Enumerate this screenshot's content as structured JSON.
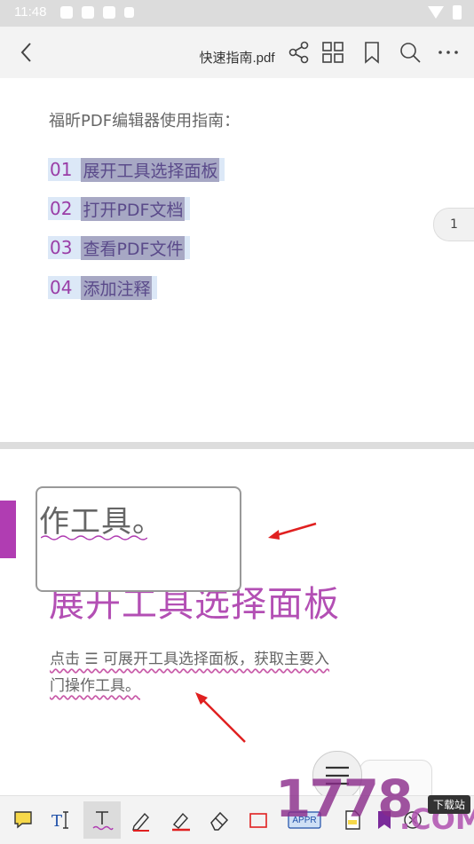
{
  "status": {
    "time": "11:48"
  },
  "toolbar": {
    "title": "快速指南.pdf"
  },
  "page1": {
    "guide_title": "福昕PDF编辑器使用指南：",
    "toc": [
      {
        "num": "01",
        "text": "展开工具选择面板"
      },
      {
        "num": "02",
        "text": "打开PDF文档"
      },
      {
        "num": "03",
        "text": "查看PDF文件"
      },
      {
        "num": "04",
        "text": "添加注释"
      }
    ],
    "page_number": "1"
  },
  "page2": {
    "magnifier_text": "作工具。",
    "heading": "展开工具选择面板",
    "paragraph_line1": "点击  ☰  可展开工具选择面板，获取主要入",
    "paragraph_line2": "门操作工具。"
  },
  "bottombar": {
    "stamp_label": "APPR"
  },
  "watermark": {
    "number": "1778",
    "domain": ".COM",
    "tag": "下载站"
  },
  "colors": {
    "accent": "#b03db2",
    "highlight": "#dce8f7",
    "arrow": "#e02020"
  }
}
